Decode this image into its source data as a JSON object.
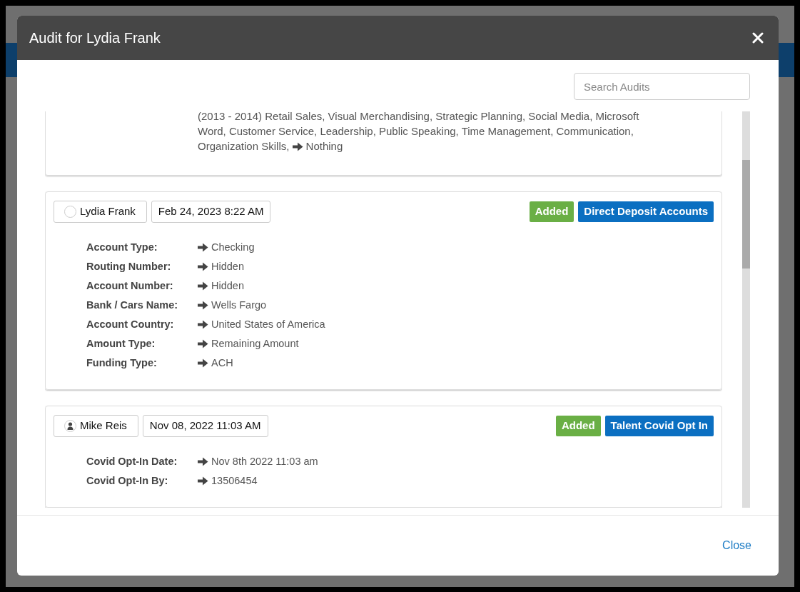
{
  "modal": {
    "title": "Audit for Lydia Frank",
    "search": {
      "placeholder": "Search Audits"
    },
    "partial_entry": {
      "text": "(2013 - 2014) Retail Sales, Visual Merchandising, Strategic Planning, Social Media, Microsoft Word, Customer Service, Leadership, Public Speaking, Time Management, Communication, Organization Skills,",
      "new_value": "Nothing"
    },
    "entries": [
      {
        "user": "Lydia Frank",
        "avatar": {
          "kind": "empty"
        },
        "date": "Feb 24, 2023 8:22 AM",
        "action": "Added",
        "category": "Direct Deposit Accounts",
        "fields": [
          {
            "label": "Account Type:",
            "value": "Checking"
          },
          {
            "label": "Routing Number:",
            "value": "Hidden"
          },
          {
            "label": "Account Number:",
            "value": "Hidden"
          },
          {
            "label": "Bank / Cars Name:",
            "value": "Wells Fargo"
          },
          {
            "label": "Account Country:",
            "value": "United States of America"
          },
          {
            "label": "Amount Type:",
            "value": "Remaining Amount"
          },
          {
            "label": "Funding Type:",
            "value": "ACH"
          }
        ]
      },
      {
        "user": "Mike Reis",
        "avatar": {
          "kind": "person"
        },
        "date": "Nov 08, 2022 11:03 AM",
        "action": "Added",
        "category": "Talent Covid Opt In",
        "fields": [
          {
            "label": "Covid Opt-In Date:",
            "value": "Nov 8th 2022 11:03 am"
          },
          {
            "label": "Covid Opt-In By:",
            "value": "13506454"
          }
        ]
      }
    ],
    "close_button": "Close"
  }
}
